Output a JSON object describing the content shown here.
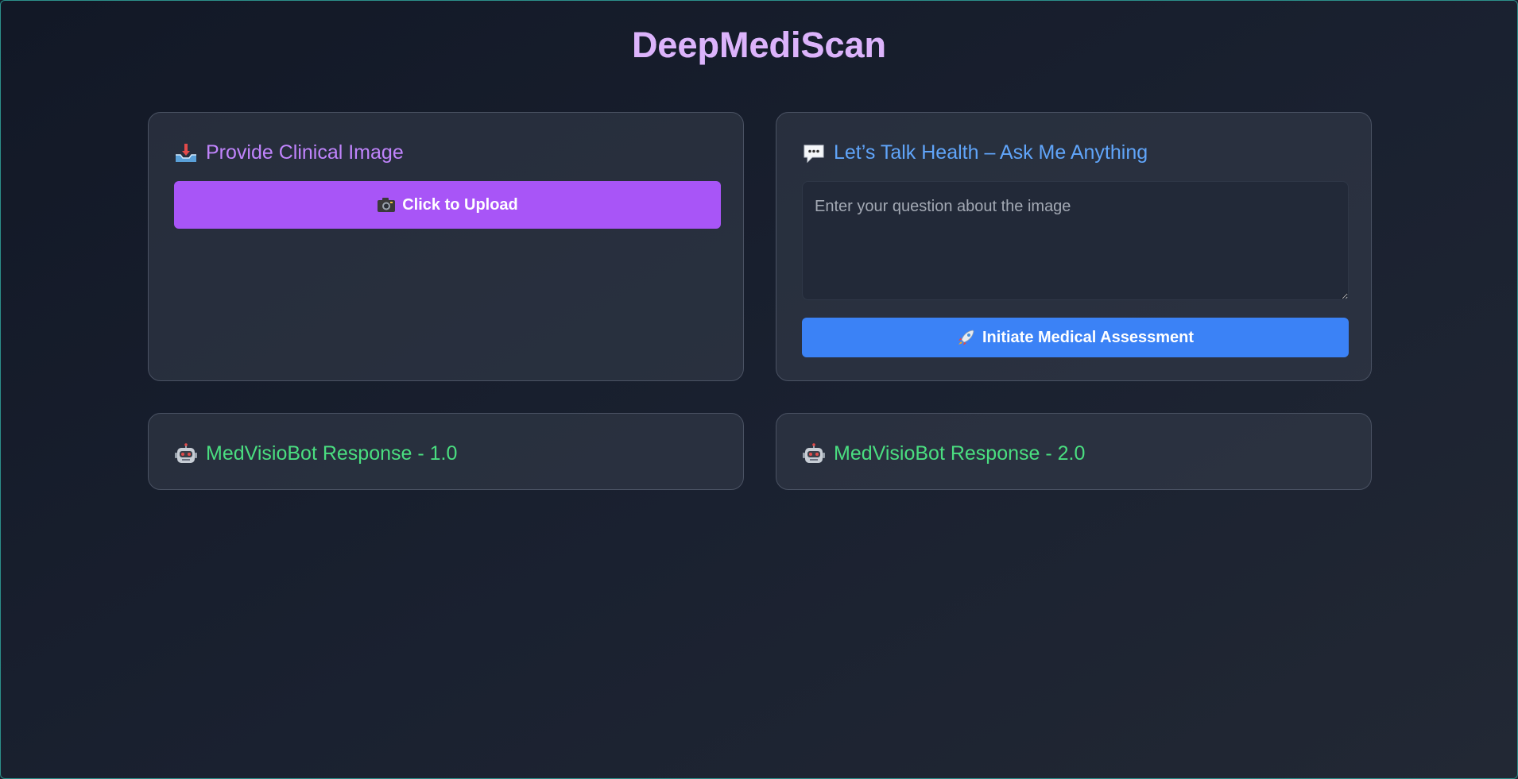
{
  "app": {
    "title": "DeepMediScan"
  },
  "upload_card": {
    "title": "Provide Clinical Image",
    "icon": "inbox-tray-icon",
    "button_label": "Click to Upload",
    "button_icon": "camera-icon"
  },
  "question_card": {
    "title": "Let’s Talk Health – Ask Me Anything",
    "icon": "speech-bubble-icon",
    "input_value": "",
    "input_placeholder": "Enter your question about the image",
    "button_label": "Initiate Medical Assessment",
    "button_icon": "rocket-icon"
  },
  "response_1": {
    "title": "MedVisioBot Response - 1.0",
    "icon": "robot-icon"
  },
  "response_2": {
    "title": "MedVisioBot Response - 2.0",
    "icon": "robot-icon"
  },
  "colors": {
    "title": "#d8b4fe",
    "upload_accent": "#a855f7",
    "question_accent": "#3b82f6",
    "response_accent": "#4ade80",
    "background": "#161c28"
  }
}
